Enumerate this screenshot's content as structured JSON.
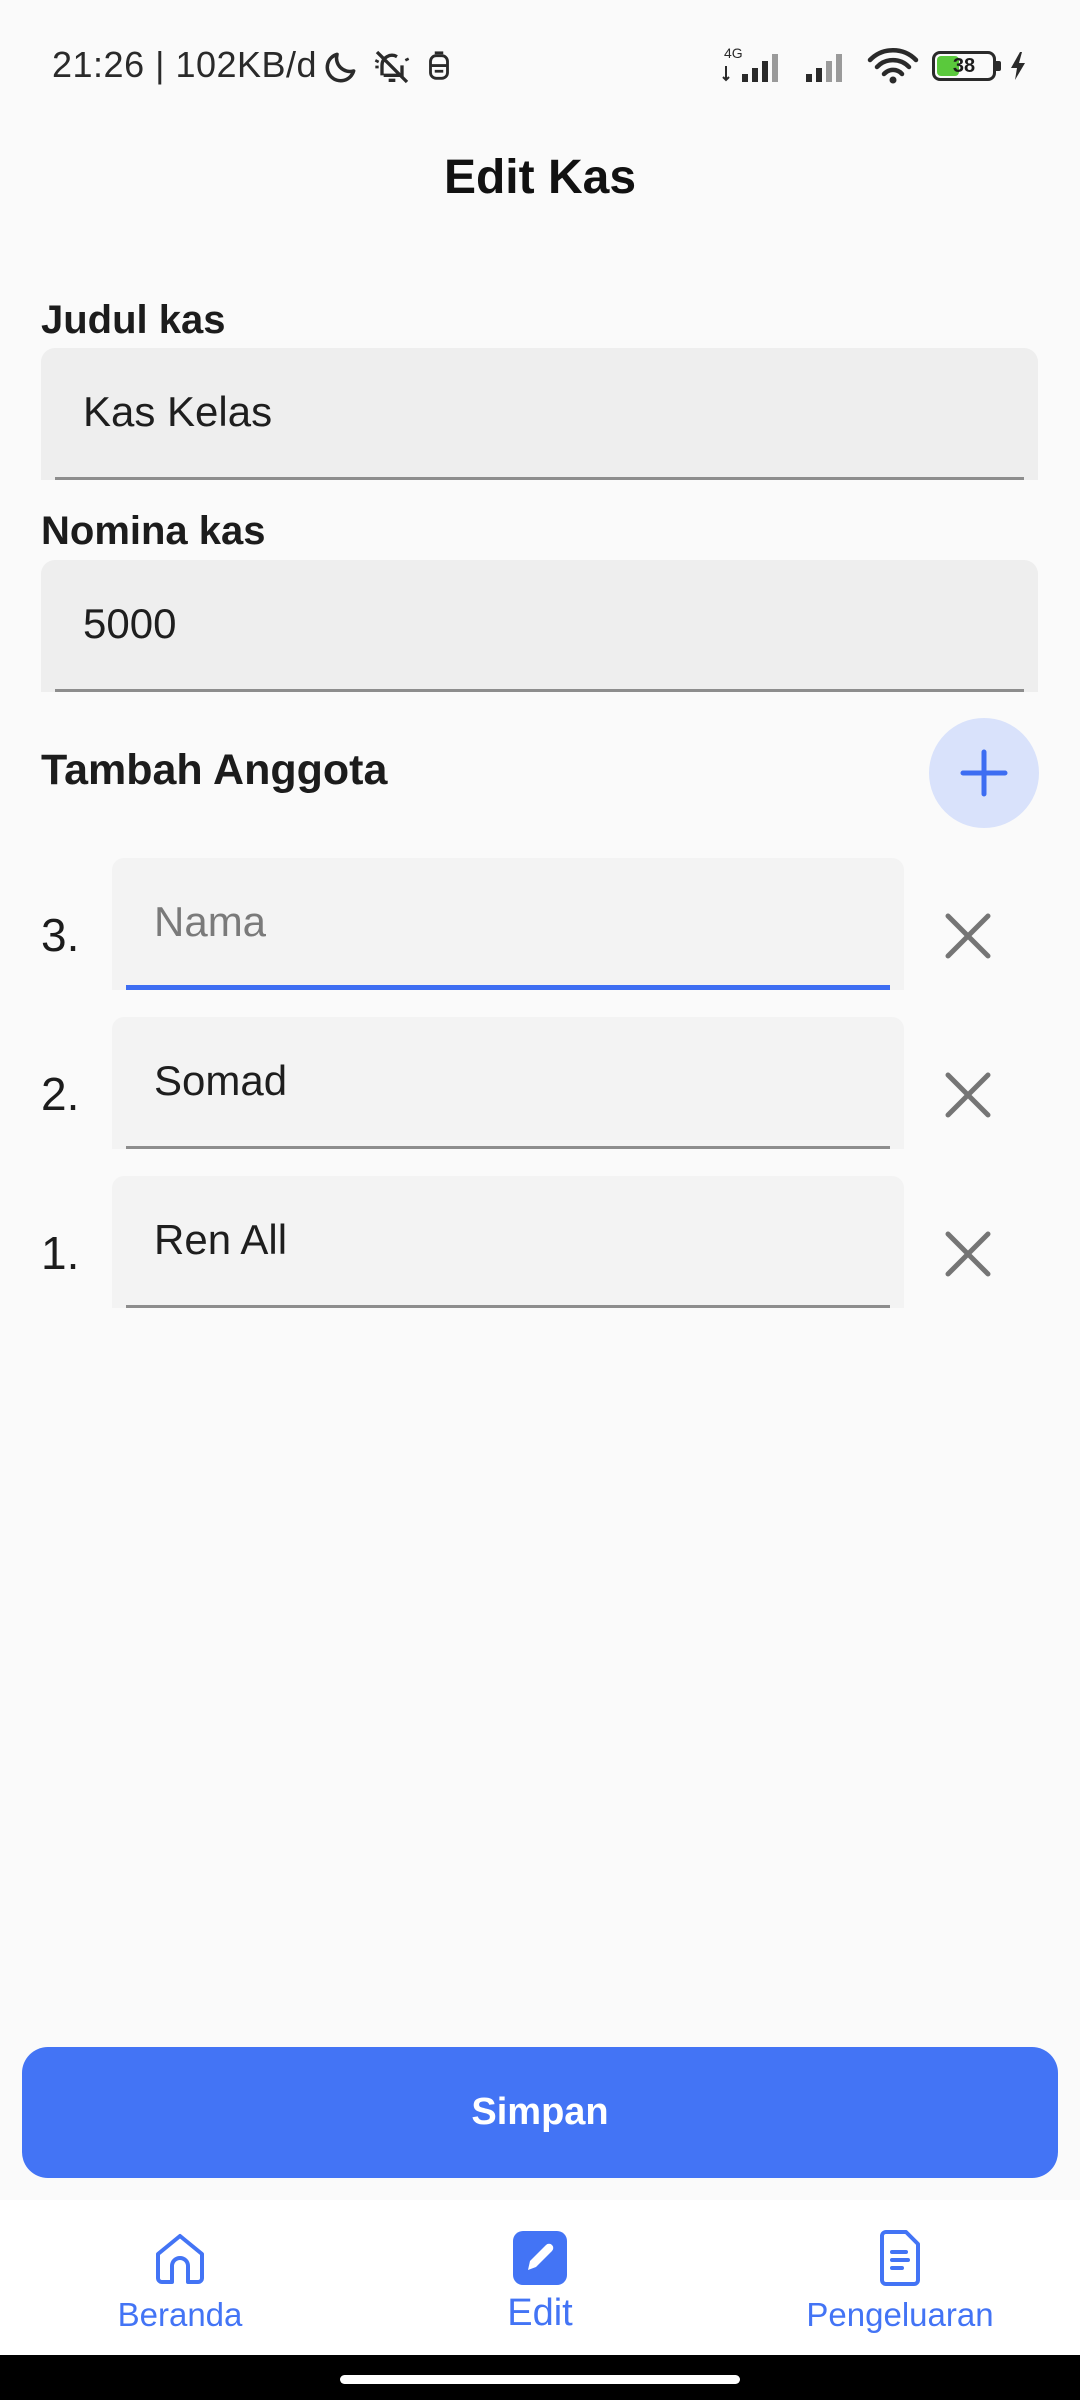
{
  "status_bar": {
    "time_speed": "21:26 | 102KB/d",
    "network": "4G",
    "battery_level": "38",
    "battery_fraction": 0.38,
    "icons": [
      "moon-icon",
      "bell-off-icon",
      "notification-icon",
      "signal-icon",
      "signal-icon",
      "wifi-icon",
      "battery-icon",
      "charging-icon"
    ]
  },
  "header": {
    "title": "Edit Kas"
  },
  "form": {
    "judul_label": "Judul kas",
    "judul_value": "Kas Kelas",
    "nominal_label": "Nomina kas",
    "nominal_value": "5000",
    "members_label": "Tambah Anggota",
    "members": [
      {
        "number": "3.",
        "value": "",
        "placeholder": "Nama",
        "focused": true
      },
      {
        "number": "2.",
        "value": "Somad",
        "placeholder": "",
        "focused": false
      },
      {
        "number": "1.",
        "value": "Ren All",
        "placeholder": "",
        "focused": false
      }
    ]
  },
  "actions": {
    "save_label": "Simpan"
  },
  "bottom_nav": {
    "items": [
      {
        "label": "Beranda",
        "icon": "home-icon",
        "active": false
      },
      {
        "label": "Edit",
        "icon": "edit-icon",
        "active": true
      },
      {
        "label": "Pengeluaran",
        "icon": "document-icon",
        "active": false
      }
    ]
  },
  "colors": {
    "accent": "#4374f5",
    "add_button_bg": "#d9e2fb",
    "field_bg": "#eeeeee",
    "page_bg": "#fafafa"
  }
}
